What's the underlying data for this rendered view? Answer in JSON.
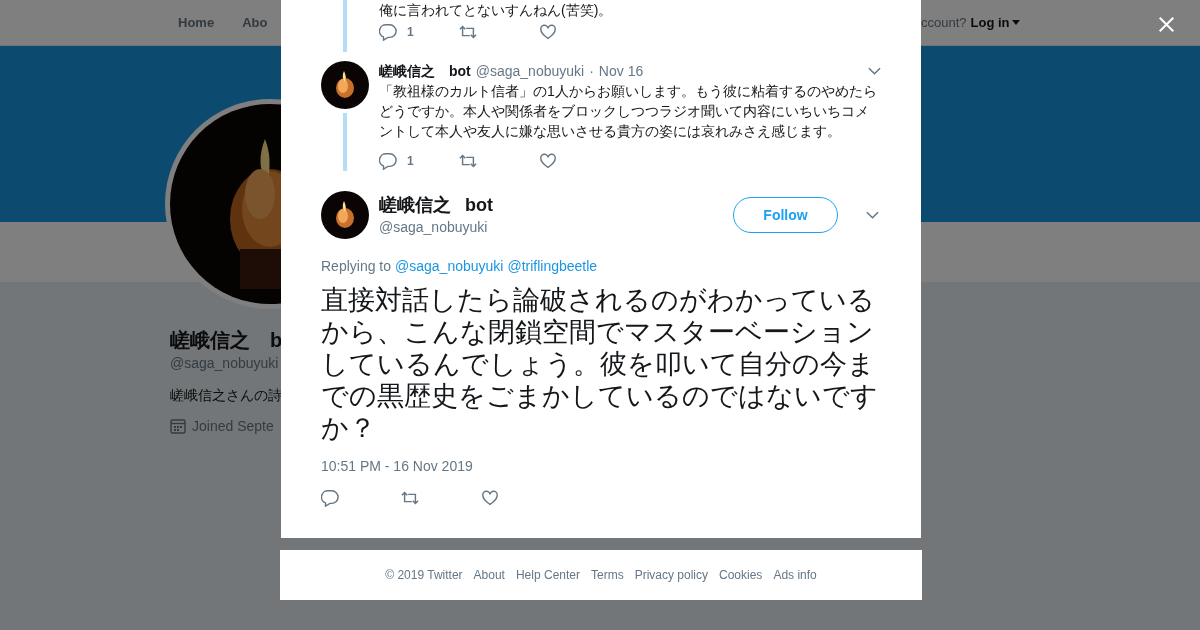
{
  "nav": {
    "home": "Home",
    "about": "Abo",
    "account_prompt": "ccount?",
    "login": "Log in"
  },
  "profile": {
    "name": "嵯峨信之　b",
    "handle": "@saga_nobuyuki",
    "bio": "嵯峨信之さんの詩",
    "joined": "Joined Septe"
  },
  "thread": [
    {
      "kind": "partial",
      "text": "俺に言われてとないすんねん(苦笑)。",
      "reply_count": "1"
    },
    {
      "kind": "full",
      "name": "嵯峨信之",
      "tag": "bot",
      "handle": "@saga_nobuyuki",
      "separator": "·",
      "date": "Nov 16",
      "text": "「教祖様のカルト信者」の1人からお願いします。もう彼に粘着するのやめたらどうですか。本人や関係者をブロックしつつラジオ聞いて内容にいちいちコメントして本人や友人に嫌な思いさせる貴方の姿には哀れみさえ感じます。",
      "reply_count": "1"
    }
  ],
  "tweet": {
    "name": "嵯峨信之",
    "tag": "bot",
    "handle": "@saga_nobuyuki",
    "follow": "Follow",
    "replying_prefix": "Replying to",
    "mentions": [
      "@saga_nobuyuki",
      "@triflingbeetle"
    ],
    "text": "直接対話したら論破されるのがわかっているから、こんな閉鎖空間でマスターベーションしているんでしょう。彼を叩いて自分の今までの黒歴史をごまかしているのではないですか？",
    "timestamp": "10:51 PM - 16 Nov 2019"
  },
  "footer": [
    "© 2019 Twitter",
    "About",
    "Help Center",
    "Terms",
    "Privacy policy",
    "Cookies",
    "Ads info"
  ]
}
